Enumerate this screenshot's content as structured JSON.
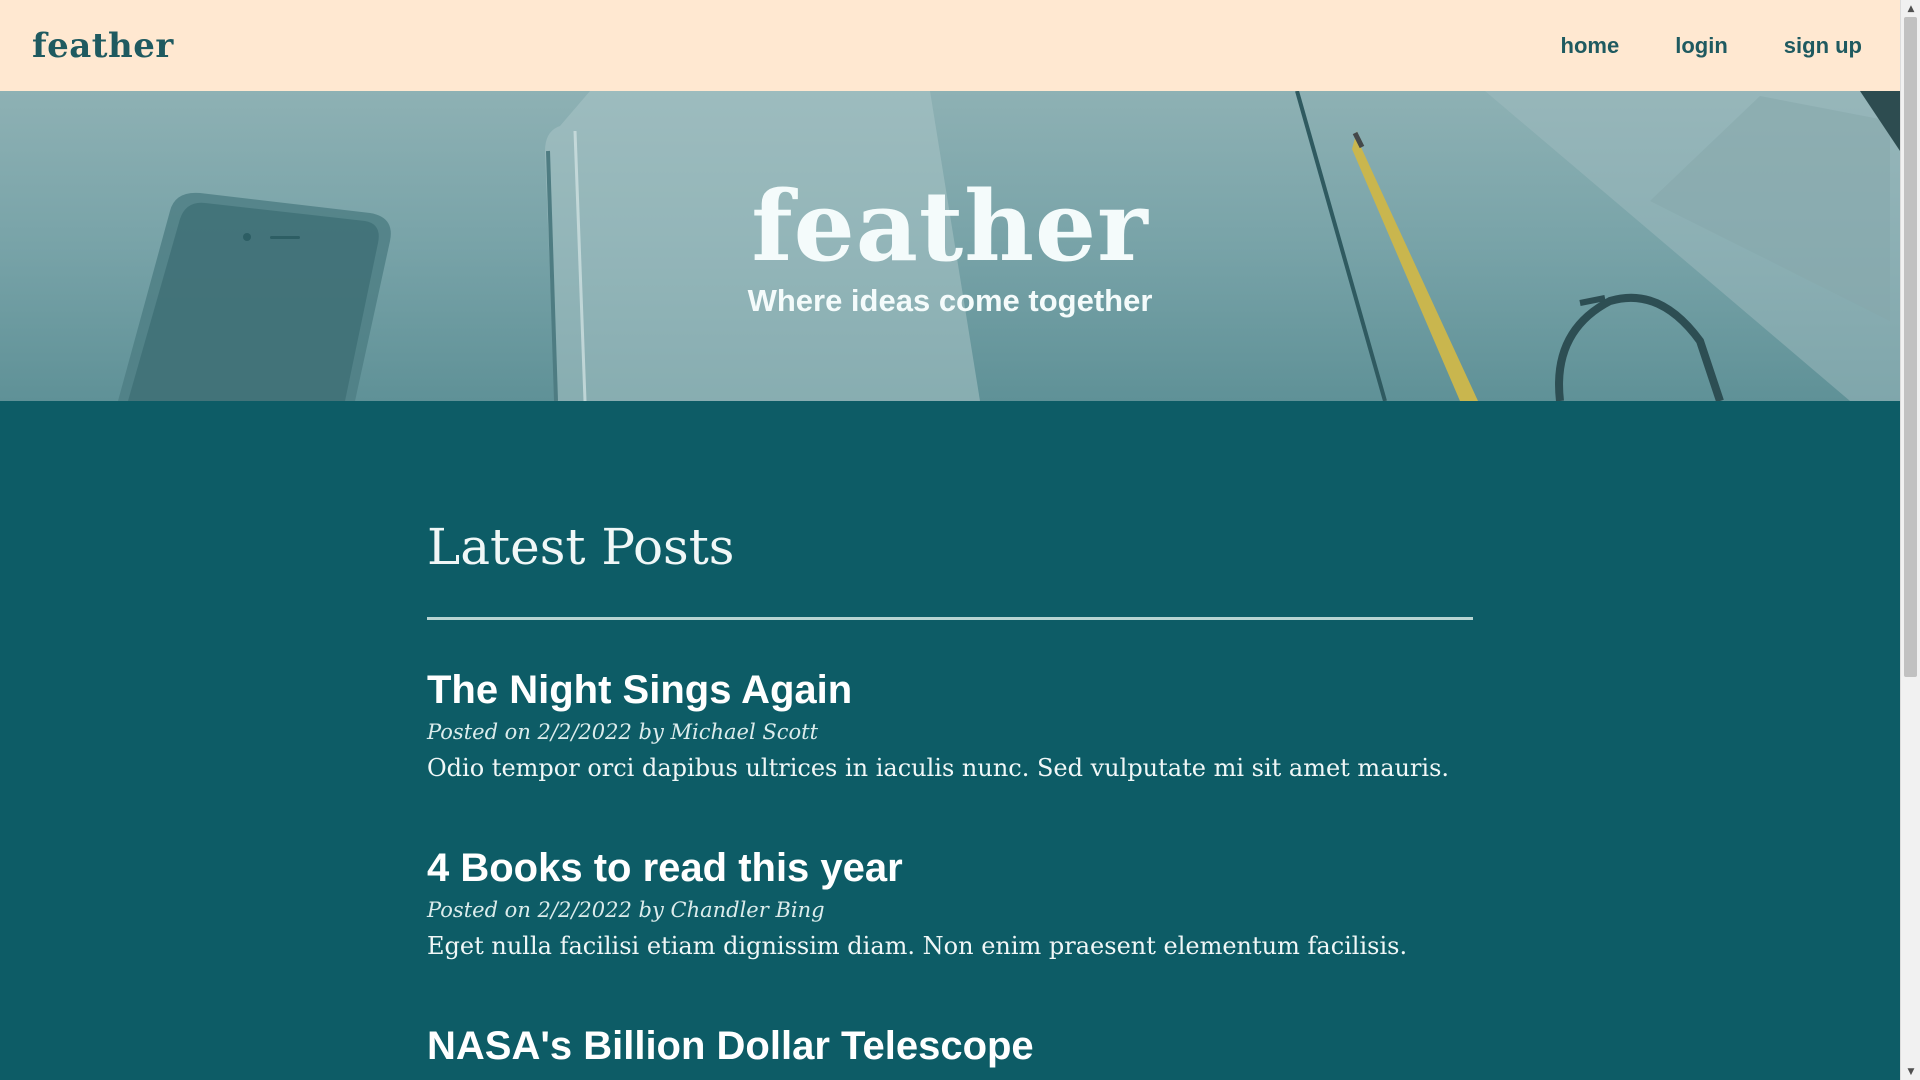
{
  "navbar": {
    "brand": "feather",
    "links": [
      "home",
      "login",
      "sign up"
    ]
  },
  "hero": {
    "title": "feather",
    "subtitle": "Where ideas come together"
  },
  "main": {
    "section_title": "Latest Posts",
    "posts": [
      {
        "title": "The Night Sings Again",
        "meta": "Posted on 2/2/2022 by Michael Scott",
        "excerpt": "Odio tempor orci dapibus ultrices in iaculis nunc. Sed vulputate mi sit amet mauris."
      },
      {
        "title": "4 Books to read this year",
        "meta": "Posted on 2/2/2022 by Chandler Bing",
        "excerpt": "Eget nulla facilisi etiam dignissim diam. Non enim praesent elementum facilisis."
      },
      {
        "title": "NASA's Billion Dollar Telescope",
        "meta": "",
        "excerpt": ""
      }
    ]
  },
  "scrollbar": {
    "up_icon": "scroll-up-arrow-icon",
    "down_icon": "scroll-down-arrow-icon"
  },
  "colors": {
    "navbar_bg": "#ffe8d1",
    "brand_text": "#1f5a60",
    "main_bg": "#0d5c66",
    "hero_overlay": "#78a3a8"
  }
}
